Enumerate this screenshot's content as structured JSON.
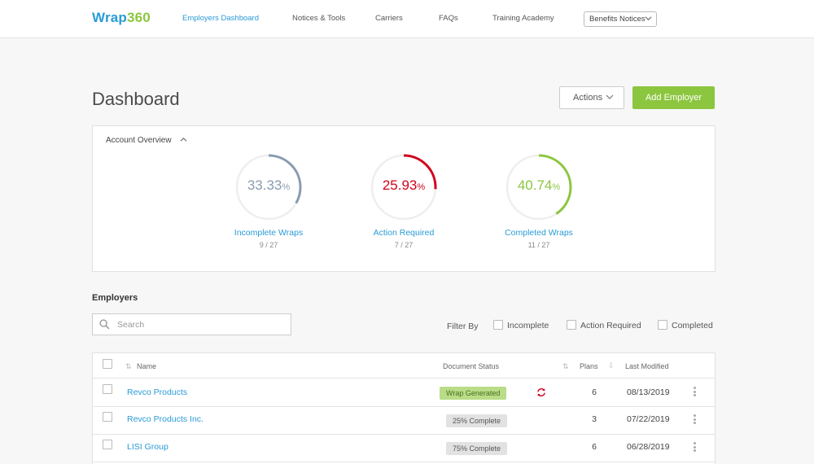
{
  "brand": {
    "part1": "Wrap",
    "part2": "360"
  },
  "nav": {
    "links": [
      "Employers Dashboard",
      "Notices & Tools",
      "Carriers",
      "FAQs",
      "Training Academy"
    ],
    "select_label": "Benefits Notices"
  },
  "header": {
    "title": "Dashboard",
    "actions_label": "Actions",
    "add_label": "Add Employer"
  },
  "overview": {
    "title": "Account Overview",
    "gauges": [
      {
        "value": "33.33",
        "unit": "%",
        "label": "Incomplete Wraps",
        "count": "9 / 27",
        "fraction": 0.3333,
        "color": "#8a9bb0"
      },
      {
        "value": "25.93",
        "unit": "%",
        "label": "Action Required",
        "count": "7 / 27",
        "fraction": 0.2593,
        "color": "#d0021b"
      },
      {
        "value": "40.74",
        "unit": "%",
        "label": "Completed Wraps",
        "count": "11 / 27",
        "fraction": 0.4074,
        "color": "#8cc63f"
      }
    ]
  },
  "employers": {
    "title": "Employers",
    "search_placeholder": "Search",
    "filter_label": "Filter By",
    "filters": [
      "Incomplete",
      "Action Required",
      "Completed"
    ],
    "columns": {
      "name": "Name",
      "status": "Document Status",
      "plans": "Plans",
      "modified": "Last Modified"
    },
    "rows": [
      {
        "name": "Revco Products",
        "status": "Wrap Generated",
        "plans": "6",
        "modified": "08/13/2019"
      },
      {
        "name": "Revco Products Inc.",
        "status": "25% Complete",
        "plans": "3",
        "modified": "07/22/2019"
      },
      {
        "name": "LISI Group",
        "status": "75% Complete",
        "plans": "6",
        "modified": "06/28/2019"
      }
    ]
  },
  "colors": {
    "accent_blue": "#2a9bd7",
    "accent_green": "#8cc63f",
    "alert_red": "#d0021b"
  }
}
